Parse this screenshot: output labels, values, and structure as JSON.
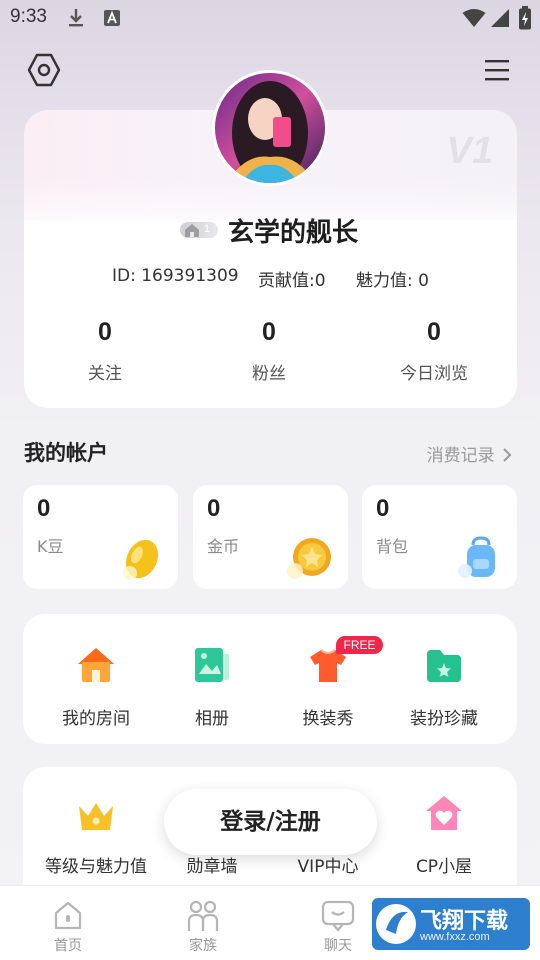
{
  "status_bar": {
    "time": "9:33"
  },
  "profile": {
    "vip_watermark": "V1",
    "level": "1",
    "username": "玄学的舰长",
    "id_text": "ID: 169391309",
    "contribution_text": "贡献值:0",
    "charm_text": "魅力值: 0",
    "counts": [
      {
        "value": "0",
        "label": "关注"
      },
      {
        "value": "0",
        "label": "粉丝"
      },
      {
        "value": "0",
        "label": "今日浏览"
      }
    ]
  },
  "account": {
    "title": "我的帐户",
    "link": "消费记录",
    "cards": [
      {
        "value": "0",
        "label": "K豆",
        "icon": "bean-icon"
      },
      {
        "value": "0",
        "label": "金币",
        "icon": "coin-icon"
      },
      {
        "value": "0",
        "label": "背包",
        "icon": "backpack-icon"
      }
    ]
  },
  "features": {
    "items": [
      {
        "label": "我的房间",
        "icon": "house-icon"
      },
      {
        "label": "相册",
        "icon": "album-icon"
      },
      {
        "label": "换装秀",
        "icon": "tshirt-icon"
      },
      {
        "label": "装扮珍藏",
        "icon": "collection-folder-icon"
      }
    ],
    "free_badge": "FREE"
  },
  "privileges": {
    "items": [
      {
        "label": "等级与魅力值",
        "icon": "crown-icon"
      },
      {
        "label": "勋章墙",
        "icon": "medal-icon"
      },
      {
        "label": "VIP中心",
        "icon": "vip-icon"
      },
      {
        "label": "CP小屋",
        "icon": "heart-house-icon"
      }
    ]
  },
  "login_button": "登录/注册",
  "bottom_nav": [
    {
      "label": "首页",
      "icon": "home-icon"
    },
    {
      "label": "家族",
      "icon": "family-icon"
    },
    {
      "label": "聊天",
      "icon": "chat-icon"
    }
  ],
  "watermark": {
    "title": "飞翔下载",
    "url": "www.fxxz.com"
  },
  "colors": {
    "accent_red": "#f0264a",
    "bean_yellow": "#f5c21b",
    "album_green": "#2fc79a",
    "tshirt_orange": "#ff6a3d",
    "house_orange": "#ff8a2a",
    "cp_pink": "#ff7fb0"
  }
}
